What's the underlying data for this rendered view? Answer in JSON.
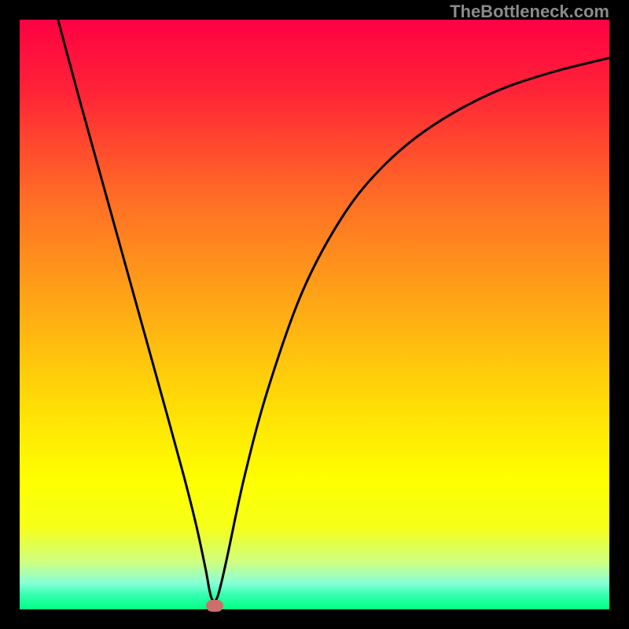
{
  "watermark": "TheBottleneck.com",
  "chart_data": {
    "type": "line",
    "title": "",
    "xlabel": "",
    "ylabel": "",
    "xlim": [
      0,
      100
    ],
    "ylim": [
      0,
      100
    ],
    "gradient_stops": [
      {
        "offset": 0,
        "color": "#ff0143"
      },
      {
        "offset": 0.12,
        "color": "#ff2337"
      },
      {
        "offset": 0.3,
        "color": "#ff6c26"
      },
      {
        "offset": 0.5,
        "color": "#ffad14"
      },
      {
        "offset": 0.66,
        "color": "#ffdf06"
      },
      {
        "offset": 0.78,
        "color": "#feff00"
      },
      {
        "offset": 0.86,
        "color": "#f5ff19"
      },
      {
        "offset": 0.92,
        "color": "#ceff82"
      },
      {
        "offset": 0.955,
        "color": "#88ffd8"
      },
      {
        "offset": 0.975,
        "color": "#35ffb0"
      },
      {
        "offset": 1.0,
        "color": "#00ff85"
      }
    ],
    "series": [
      {
        "name": "bottleneck-curve",
        "x": [
          6.5,
          10,
          15,
          20,
          25,
          28,
          30,
          31.5,
          32.5,
          33.5,
          35,
          38,
          42,
          48,
          55,
          62,
          70,
          80,
          90,
          100
        ],
        "y": [
          100,
          87,
          69,
          51,
          33,
          22,
          14,
          7,
          2,
          2,
          8,
          22,
          37,
          54,
          67,
          75.5,
          82,
          87.5,
          91,
          93.5
        ]
      }
    ],
    "marker": {
      "x": 33,
      "y": 0,
      "color": "#cb6f6d"
    }
  }
}
